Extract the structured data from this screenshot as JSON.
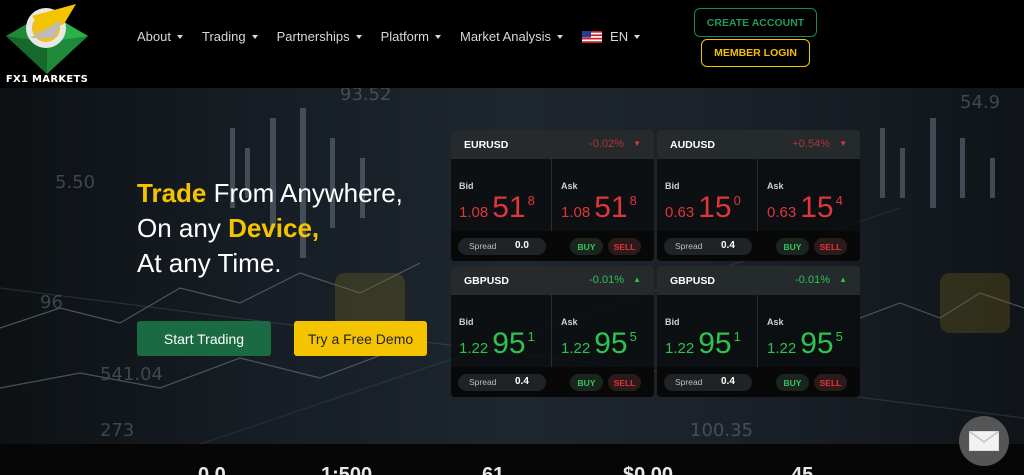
{
  "header": {
    "logo_text": "FX1 MARKETS",
    "nav": [
      {
        "label": "About"
      },
      {
        "label": "Trading"
      },
      {
        "label": "Partnerships"
      },
      {
        "label": "Platform"
      },
      {
        "label": "Market Analysis"
      },
      {
        "label": "EN"
      }
    ],
    "create_account": "CREATE ACCOUNT",
    "member_login": "MEMBER LOGIN"
  },
  "hero": {
    "line1_a": "Trade",
    "line1_b": " From Anywhere,",
    "line2_a": "On any ",
    "line2_b": "Device,",
    "line3": "At any Time.",
    "start_trading": "Start Trading",
    "free_demo": "Try a Free Demo"
  },
  "quotes": [
    {
      "symbol": "EURUSD",
      "change": "-0.02%",
      "direction": "down",
      "bid_label": "Bid",
      "bid_small": "1.08",
      "bid_big": "51",
      "bid_sup": "8",
      "ask_label": "Ask",
      "ask_small": "1.08",
      "ask_big": "51",
      "ask_sup": "8",
      "spread_label": "Spread",
      "spread": "0.0",
      "buy": "BUY",
      "sell": "SELL"
    },
    {
      "symbol": "AUDUSD",
      "change": "+0.54%",
      "direction": "down",
      "bid_label": "Bid",
      "bid_small": "0.63",
      "bid_big": "15",
      "bid_sup": "0",
      "ask_label": "Ask",
      "ask_small": "0.63",
      "ask_big": "15",
      "ask_sup": "4",
      "spread_label": "Spread",
      "spread": "0.4",
      "buy": "BUY",
      "sell": "SELL"
    },
    {
      "symbol": "GBPUSD",
      "change": "-0.01%",
      "direction": "up",
      "bid_label": "Bid",
      "bid_small": "1.22",
      "bid_big": "95",
      "bid_sup": "1",
      "ask_label": "Ask",
      "ask_small": "1.22",
      "ask_big": "95",
      "ask_sup": "5",
      "spread_label": "Spread",
      "spread": "0.4",
      "buy": "BUY",
      "sell": "SELL"
    },
    {
      "symbol": "GBPUSD",
      "change": "-0.01%",
      "direction": "up",
      "bid_label": "Bid",
      "bid_small": "1.22",
      "bid_big": "95",
      "bid_sup": "1",
      "ask_label": "Ask",
      "ask_small": "1.22",
      "ask_big": "95",
      "ask_sup": "5",
      "spread_label": "Spread",
      "spread": "0.4",
      "buy": "BUY",
      "sell": "SELL"
    }
  ],
  "stats": [
    "0.0",
    "1:500",
    "61",
    "$0.00",
    "45"
  ],
  "icons": {
    "chat": "envelope-icon",
    "nav_caret": "chevron-down-icon",
    "flag": "us-flag-icon"
  },
  "colors": {
    "brand_green": "#1a6a43",
    "brand_yellow": "#f5c400",
    "price_down": "#e0353b",
    "price_up": "#2ec24f"
  }
}
